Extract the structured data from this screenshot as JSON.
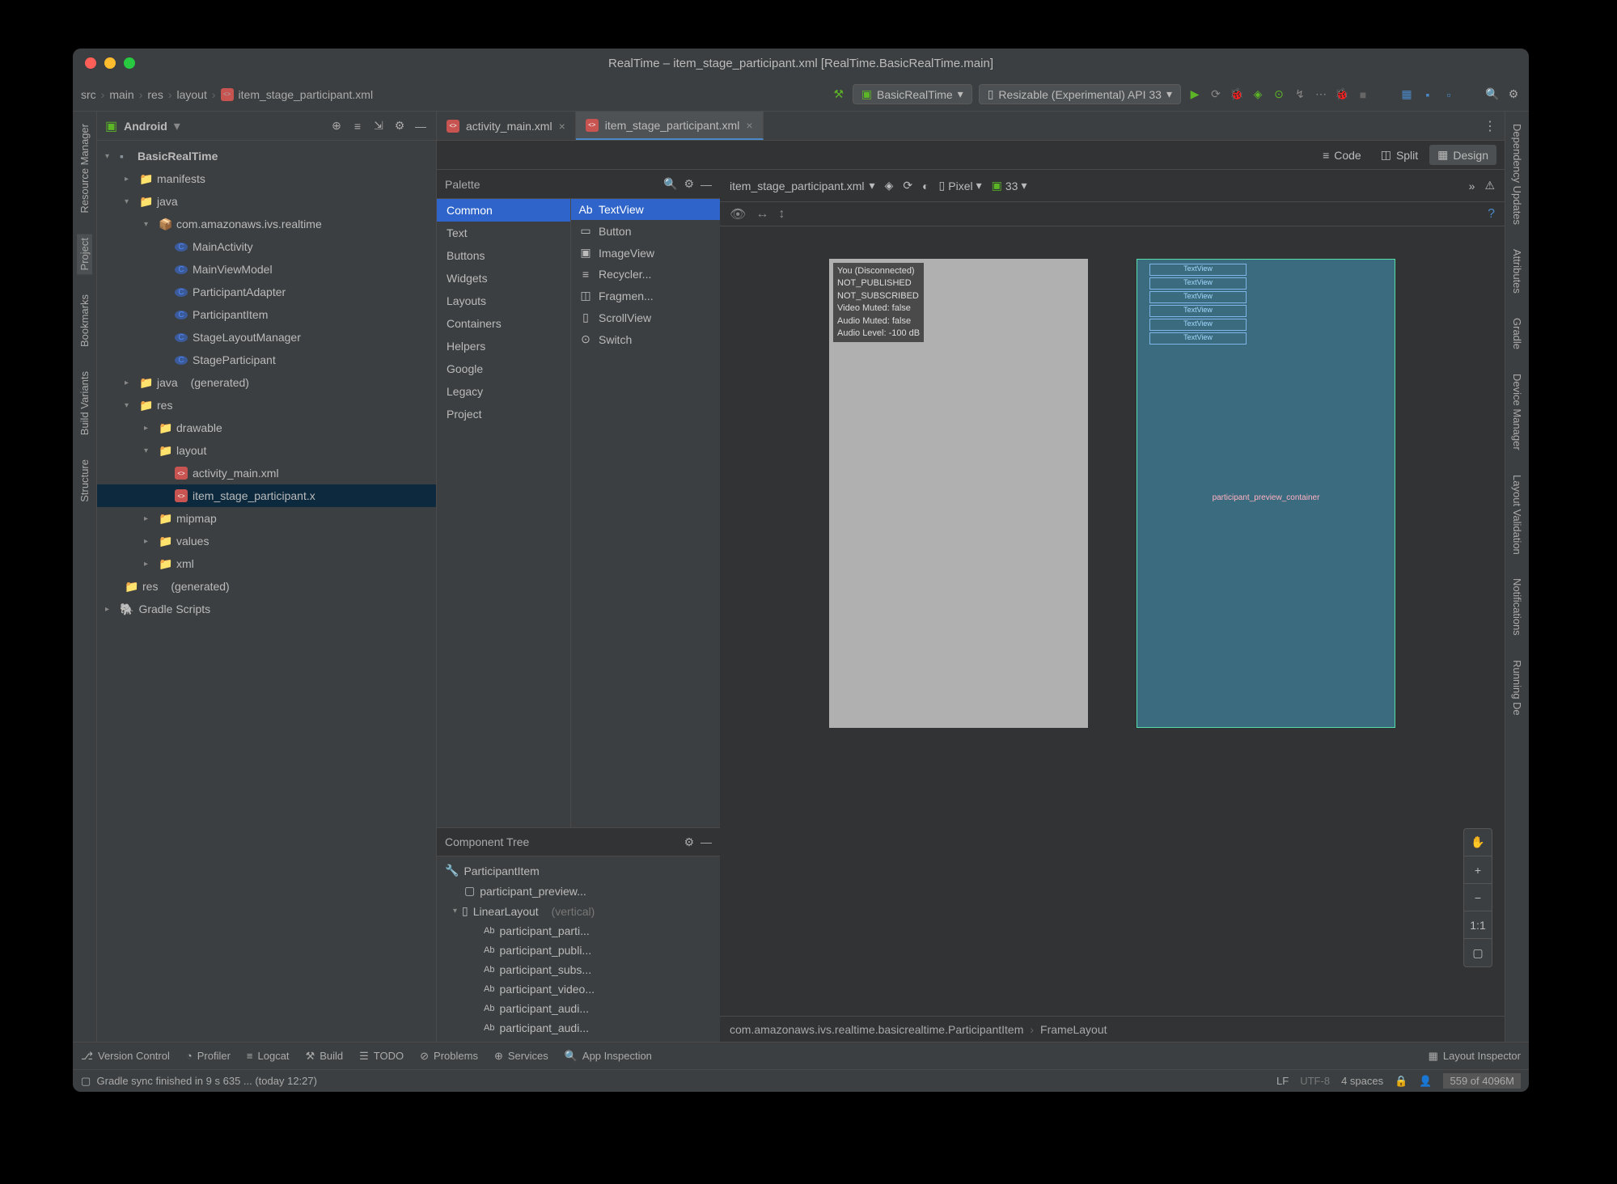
{
  "window": {
    "title": "RealTime – item_stage_participant.xml [RealTime.BasicRealTime.main]"
  },
  "breadcrumb": [
    "src",
    "main",
    "res",
    "layout",
    "item_stage_participant.xml"
  ],
  "run_config": {
    "name": "BasicRealTime"
  },
  "device_selector": {
    "label": "Resizable (Experimental) API 33"
  },
  "project_panel": {
    "title": "Android"
  },
  "project_tree": {
    "root": "BasicRealTime",
    "manifests": "manifests",
    "java": "java",
    "pkg": "com.amazonaws.ivs.realtime",
    "classes": [
      "MainActivity",
      "MainViewModel",
      "ParticipantAdapter",
      "ParticipantItem",
      "StageLayoutManager",
      "StageParticipant"
    ],
    "java_gen": "java",
    "gen": "(generated)",
    "res": "res",
    "drawable": "drawable",
    "layout": "layout",
    "layout_files": [
      "activity_main.xml",
      "item_stage_participant.x"
    ],
    "mipmap": "mipmap",
    "values": "values",
    "xml": "xml",
    "res_gen": "res",
    "gradle_scripts": "Gradle Scripts"
  },
  "file_tabs": [
    {
      "name": "activity_main.xml",
      "active": false
    },
    {
      "name": "item_stage_participant.xml",
      "active": true
    }
  ],
  "view_modes": {
    "code": "Code",
    "split": "Split",
    "design": "Design"
  },
  "palette": {
    "title": "Palette",
    "categories": [
      "Common",
      "Text",
      "Buttons",
      "Widgets",
      "Layouts",
      "Containers",
      "Helpers",
      "Google",
      "Legacy",
      "Project"
    ],
    "items": [
      "TextView",
      "Button",
      "ImageView",
      "Recycler...",
      "Fragmen...",
      "ScrollView",
      "Switch"
    ]
  },
  "component_tree": {
    "title": "Component Tree",
    "root": "ParticipantItem",
    "children": [
      "participant_preview...",
      "LinearLayout"
    ],
    "ll_hint": "(vertical)",
    "textviews": [
      "participant_parti...",
      "participant_publi...",
      "participant_subs...",
      "participant_video...",
      "participant_audi...",
      "participant_audi..."
    ]
  },
  "canvas": {
    "file_dropdown": "item_stage_participant.xml",
    "device": "Pixel",
    "api": "33",
    "preview_overlay": [
      "You (Disconnected)",
      "NOT_PUBLISHED",
      "NOT_SUBSCRIBED",
      "Video Muted: false",
      "Audio Muted: false",
      "Audio Level: -100 dB"
    ],
    "blueprint_center": "participant_preview_container",
    "breadcrumb_base": "com.amazonaws.ivs.realtime.basicrealtime.ParticipantItem",
    "breadcrumb_last": "FrameLayout"
  },
  "left_tabs": [
    "Resource Manager",
    "Project",
    "Bookmarks",
    "Build Variants",
    "Structure"
  ],
  "right_tabs": [
    "Dependency Updates",
    "Attributes",
    "Gradle",
    "Device Manager",
    "Layout Validation",
    "Notifications",
    "Running De"
  ],
  "bottom_toolbar": {
    "version_control": "Version Control",
    "profiler": "Profiler",
    "logcat": "Logcat",
    "build": "Build",
    "todo": "TODO",
    "problems": "Problems",
    "services": "Services",
    "app_inspection": "App Inspection",
    "layout_inspector": "Layout Inspector"
  },
  "statusbar": {
    "msg": "Gradle sync finished in 9 s 635 ... (today 12:27)",
    "lf": "LF",
    "encoding": "UTF-8",
    "indent": "4 spaces",
    "memory": "559 of 4096M"
  },
  "zoom": {
    "one_to_one": "1:1"
  }
}
